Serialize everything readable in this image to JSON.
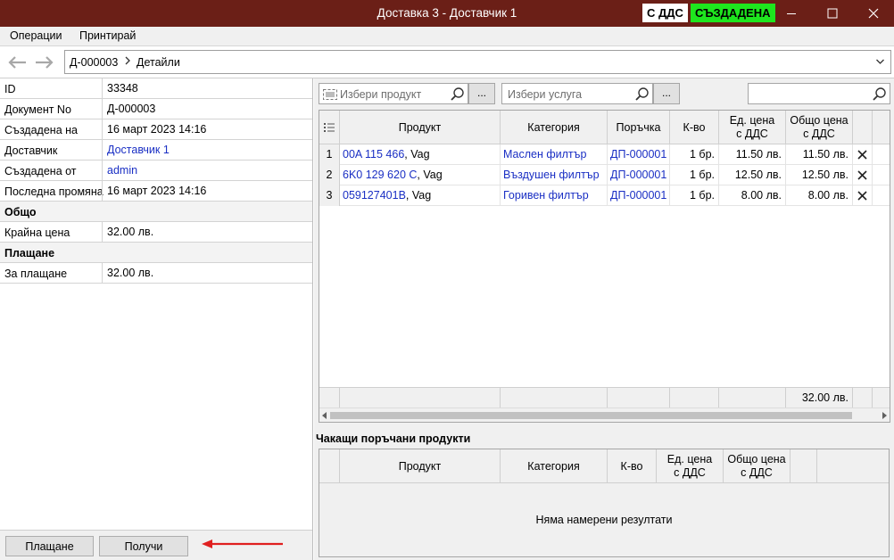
{
  "window": {
    "title": "Доставка 3 - Доставчик 1",
    "badge_vat": "С ДДС",
    "badge_status": "СЪЗДАДЕНА",
    "colors": {
      "titlebar": "#6b1f17",
      "status_badge": "#1ee61e",
      "link": "#1a2fc4",
      "annotation_arrow": "#e02020"
    }
  },
  "menu": {
    "operations": "Операции",
    "print": "Принтирай"
  },
  "nav": {
    "crumb_doc": "Д-000003",
    "crumb_details": "Детайли"
  },
  "details": {
    "id_label": "ID",
    "id_value": "33348",
    "docno_label": "Документ No",
    "docno_value": "Д-000003",
    "created_label": "Създадена на",
    "created_value": "16 март 2023 14:16",
    "supplier_label": "Доставчик",
    "supplier_value": "Доставчик 1",
    "createdby_label": "Създадена от",
    "createdby_value": "admin",
    "modified_label": "Последна промяна",
    "modified_value": "16 март 2023 14:16",
    "total_section": "Общо",
    "final_price_label": "Крайна цена",
    "final_price_value": "32.00 лв.",
    "payment_section": "Плащане",
    "to_pay_label": "За плащане",
    "to_pay_value": "32.00 лв."
  },
  "buttons": {
    "payment": "Плащане",
    "receive": "Получи"
  },
  "pickers": {
    "product_placeholder": "Избери продукт",
    "service_placeholder": "Избери услуга",
    "dots": "..."
  },
  "items_table": {
    "headers": {
      "product": "Продукт",
      "category": "Категория",
      "order": "Поръчка",
      "qty": "К-во",
      "unit_price_1": "Ед. цена",
      "unit_price_2": "с ДДС",
      "total_price_1": "Общо цена",
      "total_price_2": "с ДДС"
    },
    "rows": [
      {
        "n": "1",
        "product_code": "00A 115 466",
        "brand": ", Vag",
        "category": "Маслен филтър",
        "order": "ДП-000001",
        "qty": "1 бр.",
        "unit_price": "11.50 лв.",
        "total": "11.50 лв."
      },
      {
        "n": "2",
        "product_code": "6K0 129 620 C",
        "brand": ", Vag",
        "category": "Въздушен филтър",
        "order": "ДП-000001",
        "qty": "1 бр.",
        "unit_price": "12.50 лв.",
        "total": "12.50 лв."
      },
      {
        "n": "3",
        "product_code": "059127401B",
        "brand": ", Vag",
        "category": "Горивен филтър",
        "order": "ДП-000001",
        "qty": "1 бр.",
        "unit_price": "8.00 лв.",
        "total": "8.00 лв."
      }
    ],
    "footer_total": "32.00 лв."
  },
  "waiting": {
    "title": "Чакащи поръчани продукти",
    "headers": {
      "product": "Продукт",
      "category": "Категория",
      "qty": "К-во",
      "unit_price_1": "Ед. цена",
      "unit_price_2": "с ДДС",
      "total_price_1": "Общо цена",
      "total_price_2": "с ДДС"
    },
    "empty": "Няма намерени резултати"
  }
}
